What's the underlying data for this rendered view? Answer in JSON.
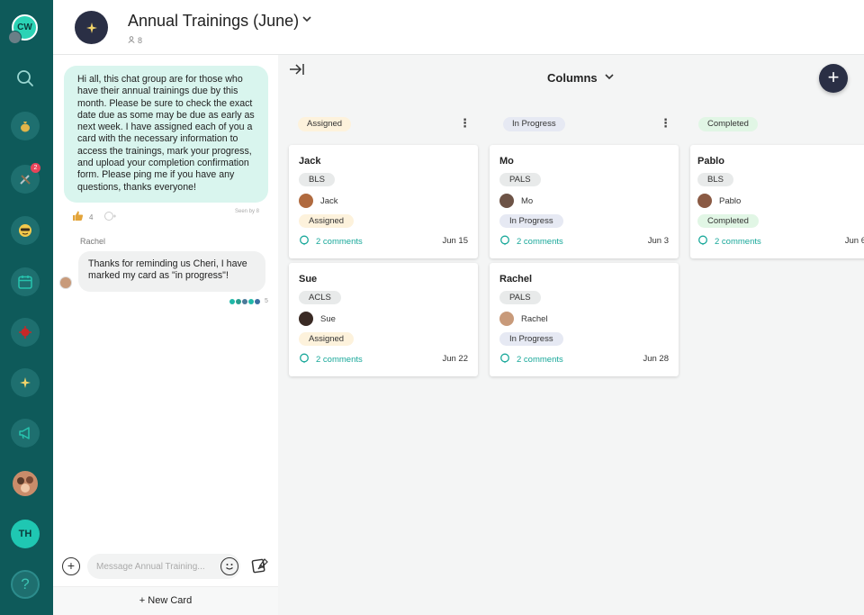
{
  "rail": {
    "me_initials": "CW",
    "notification_count": "2",
    "th_initials": "TH",
    "help_glyph": "?"
  },
  "header": {
    "title": "Annual Trainings (June)",
    "member_count": "8"
  },
  "chat": {
    "main_message": "Hi all, this chat group are for those who have their annual trainings due by this month. Please be sure to check the exact date due as some may be due as early as next week. I have assigned each of you a card with the necessary information to access the trainings, mark your progress, and upload your completion confirmation form. Please ping me if you have any questions, thanks everyone!",
    "seen_by": "Seen by 8",
    "reaction_count": "4",
    "reply_sender": "Rachel",
    "reply_message": "Thanks for reminding us Cheri, I have marked my card as \"in progress\"!",
    "read_count": "5",
    "composer_placeholder": "Message Annual Training...",
    "new_card_label": "+ New Card"
  },
  "board": {
    "view_label": "Columns",
    "columns": [
      {
        "name": "Assigned",
        "cards": [
          {
            "title": "Jack",
            "cert": "BLS",
            "assignee": "Jack",
            "status": "Assigned",
            "comments": "2 comments",
            "due": "Jun 15"
          },
          {
            "title": "Sue",
            "cert": "ACLS",
            "assignee": "Sue",
            "status": "Assigned",
            "comments": "2 comments",
            "due": "Jun 22"
          }
        ]
      },
      {
        "name": "In Progress",
        "cards": [
          {
            "title": "Mo",
            "cert": "PALS",
            "assignee": "Mo",
            "status": "In Progress",
            "comments": "2 comments",
            "due": "Jun 3"
          },
          {
            "title": "Rachel",
            "cert": "PALS",
            "assignee": "Rachel",
            "status": "In Progress",
            "comments": "2 comments",
            "due": "Jun 28"
          }
        ]
      },
      {
        "name": "Completed",
        "cards": [
          {
            "title": "Pablo",
            "cert": "BLS",
            "assignee": "Pablo",
            "status": "Completed",
            "comments": "2 comments",
            "due": "Jun 6"
          }
        ]
      }
    ]
  },
  "colors": {
    "rail_bg": "#0e5a5a",
    "accent": "#19a89a",
    "chat_bubble": "#d9f5ee",
    "assigned": "#fdf2dc",
    "in_progress": "#e6e9f3",
    "completed": "#e1f6e5"
  }
}
